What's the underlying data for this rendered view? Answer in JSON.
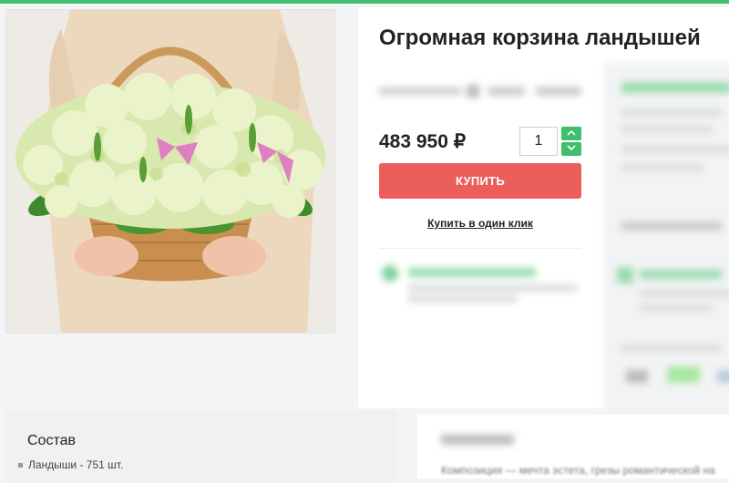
{
  "product": {
    "title": "Огромная корзина ландышей",
    "old_prices": "",
    "price": "483 950 ₽",
    "quantity": "1",
    "buy_label": "КУПИТЬ",
    "one_click_label": "Купить в один клик",
    "qty_up_icon": "chevron-up-icon",
    "qty_down_icon": "chevron-down-icon"
  },
  "composition": {
    "title": "Состав",
    "items": [
      "Ландыши - 751 шт."
    ]
  },
  "description": {
    "title": "",
    "text": "Композиция — мечта эстета, грезы романтической на"
  },
  "colors": {
    "accent_green": "#3ebf6e",
    "buy_red": "#ec5e5a"
  }
}
